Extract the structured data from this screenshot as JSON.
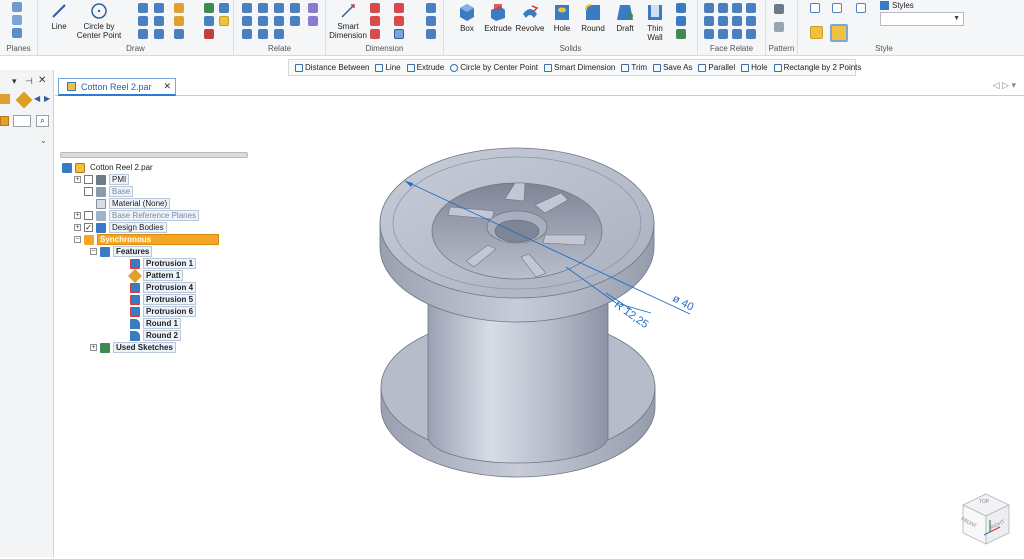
{
  "ribbon": {
    "groups": {
      "planes": "Planes",
      "draw": "Draw",
      "relate": "Relate",
      "dimension": "Dimension",
      "solids": "Solids",
      "face_relate": "Face Relate",
      "pattern": "Pattern",
      "style": "Style"
    },
    "buttons": {
      "line": "Line",
      "circle": [
        "Circle by",
        "Center Point"
      ],
      "smart_dimension": [
        "Smart",
        "Dimension"
      ],
      "box": "Box",
      "extrude": "Extrude",
      "revolve": "Revolve",
      "hole": "Hole",
      "round": "Round",
      "draft": "Draft",
      "thin_wall": [
        "Thin",
        "Wall"
      ],
      "styles": "Styles"
    }
  },
  "command_bar": [
    "Distance Between",
    "Line",
    "Extrude",
    "Circle by Center Point",
    "Smart Dimension",
    "Trim",
    "Save As",
    "Parallel",
    "Hole",
    "Rectangle by 2 Points"
  ],
  "document_tab": {
    "title": "Cotton Reel 2.par"
  },
  "tree": {
    "root": "Cotton Reel 2.par",
    "pmi": "PMI",
    "base": "Base",
    "material": "Material (None)",
    "base_planes": "Base Reference Planes",
    "design_bodies": "Design Bodies",
    "synchronous": "Synchronous",
    "features": "Features",
    "items": [
      "Protrusion 1",
      "Pattern 1",
      "Protrusion 4",
      "Protrusion 5",
      "Protrusion 6",
      "Round 1",
      "Round 2"
    ],
    "used_sketches": "Used Sketches"
  },
  "dimensions": {
    "diameter": "ø 40",
    "radius": "R 12,25"
  },
  "viewcube": {
    "top": "TOP",
    "front": "FRONT",
    "right": "RIGHT"
  },
  "colors": {
    "accent": "#2f7bd1",
    "selection": "#f5a623",
    "dimension": "#1f6fc5",
    "part": "#b9bfcc"
  }
}
